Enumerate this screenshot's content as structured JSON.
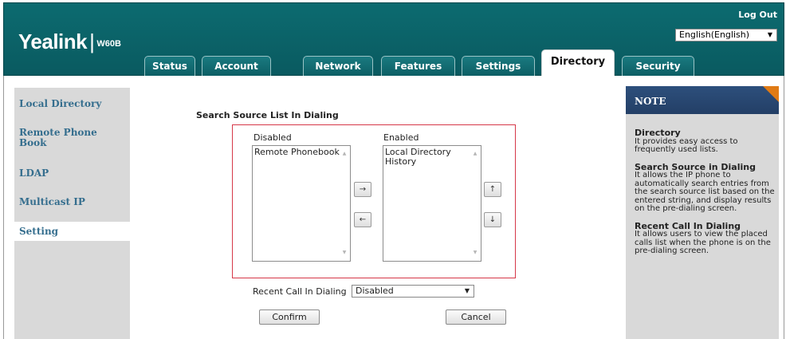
{
  "header": {
    "brand": "Yealink",
    "separator": "|",
    "model": "W60B",
    "logout": "Log Out",
    "language": "English(English)"
  },
  "tabs": [
    {
      "label": "Status"
    },
    {
      "label": "Account"
    },
    {
      "label": "Network"
    },
    {
      "label": "Features"
    },
    {
      "label": "Settings"
    },
    {
      "label": "Directory",
      "active": true
    },
    {
      "label": "Security"
    }
  ],
  "sidebar": {
    "items": [
      {
        "label": "Local Directory"
      },
      {
        "label": "Remote Phone Book"
      },
      {
        "label": "LDAP"
      },
      {
        "label": "Multicast IP"
      },
      {
        "label": "Setting",
        "active": true
      }
    ]
  },
  "main": {
    "section_title": "Search Source List In Dialing",
    "disabled_label": "Disabled",
    "enabled_label": "Enabled",
    "disabled_items": [
      "Remote Phonebook"
    ],
    "enabled_items": [
      "Local Directory",
      "History"
    ],
    "move_right": "→",
    "move_left": "←",
    "move_up": "↑",
    "move_down": "↓",
    "recent_call_label": "Recent Call In Dialing",
    "recent_call_value": "Disabled",
    "confirm": "Confirm",
    "cancel": "Cancel"
  },
  "note": {
    "title": "NOTE",
    "blocks": [
      {
        "heading": "Directory",
        "text": "It provides easy access to frequently used lists."
      },
      {
        "heading": "Search Source in Dialing",
        "text": "It allows the IP phone to automatically search entries from the search source list based on the entered string, and display results on the pre-dialing screen."
      },
      {
        "heading": "Recent Call In Dialing",
        "text": "It allows users to view the placed calls list when the phone is on the pre-dialing screen."
      }
    ]
  },
  "colors": {
    "header": "#0a5a60",
    "sidebar_text": "#356e8e",
    "note_header": "#2d4f7c",
    "note_corner": "#e07b15",
    "highlight_box": "#d63848"
  }
}
